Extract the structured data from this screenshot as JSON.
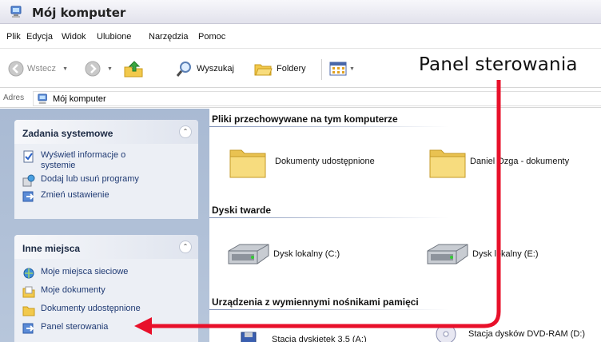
{
  "window": {
    "title": "Mój komputer"
  },
  "menu": [
    "Plik",
    "Edycja",
    "Widok",
    "Ulubione",
    "Narzędzia",
    "Pomoc"
  ],
  "toolbar": {
    "back": "Wstecz",
    "search": "Wyszukaj",
    "folders": "Foldery"
  },
  "annotation": "Panel sterowania",
  "address": {
    "label": "Adres",
    "value": "Mój komputer"
  },
  "left": {
    "system_tasks": {
      "title": "Zadania systemowe",
      "items": [
        "Wyświetl informacje o systemie",
        "Dodaj lub usuń programy",
        "Zmień ustawienie"
      ]
    },
    "other_places": {
      "title": "Inne miejsca",
      "items": [
        "Moje miejsca sieciowe",
        "Moje dokumenty",
        "Dokumenty udostępnione",
        "Panel sterowania"
      ]
    }
  },
  "main": {
    "groups": [
      {
        "title": "Pliki przechowywane na tym komputerze",
        "items": [
          "Dokumenty udostępnione",
          "Daniel Ozga - dokumenty"
        ]
      },
      {
        "title": "Dyski twarde",
        "items": [
          "Dysk lokalny (C:)",
          "Dysk lokalny (E:)"
        ]
      },
      {
        "title": "Urządzenia z wymiennymi nośnikami pamięci",
        "items": [
          "Stacja dyskietek 3,5 (A:)",
          "Stacja dysków DVD-RAM (D:)"
        ]
      }
    ]
  },
  "colors": {
    "arrow": "#e8102a",
    "taskLink": "#1f3a73",
    "leftPane": "#b0c0d8"
  }
}
